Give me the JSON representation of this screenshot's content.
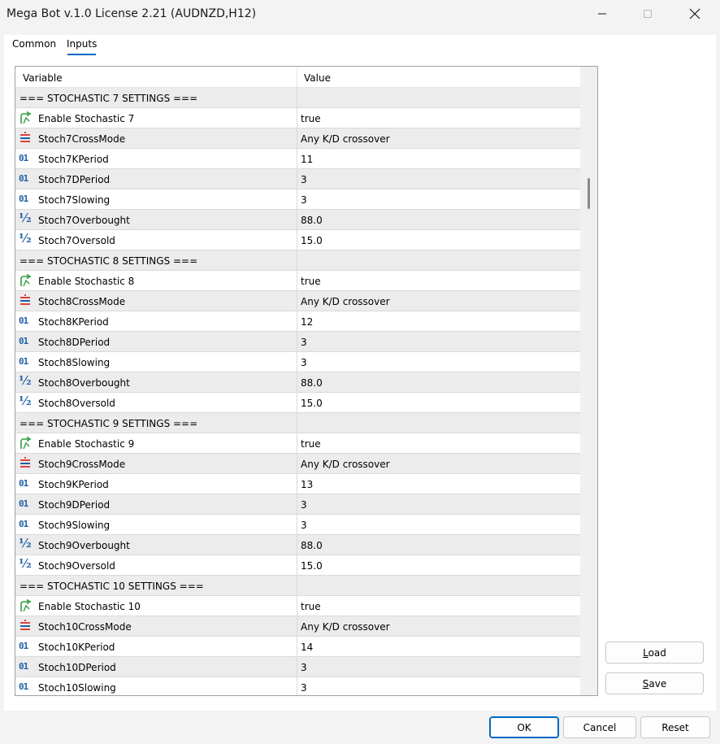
{
  "window": {
    "title": "Mega Bot v.1.0 License 2.21 (AUDNZD,H12)"
  },
  "tabs": [
    {
      "label": "Common"
    },
    {
      "label": "Inputs"
    }
  ],
  "grid": {
    "columns": {
      "variable": "Variable",
      "value": "Value"
    },
    "rows": [
      {
        "type": "section",
        "variable": "=== STOCHASTIC 7 SETTINGS ===",
        "value": ""
      },
      {
        "type": "bool",
        "icon": "bool-arrow-icon",
        "variable": "Enable Stochastic 7",
        "value": "true"
      },
      {
        "type": "enum",
        "icon": "enum-list-icon",
        "variable": "Stoch7CrossMode",
        "value": "Any K/D crossover"
      },
      {
        "type": "int",
        "icon": "integer-icon",
        "variable": "Stoch7KPeriod",
        "value": "11"
      },
      {
        "type": "int",
        "icon": "integer-icon",
        "variable": "Stoch7DPeriod",
        "value": "3"
      },
      {
        "type": "int",
        "icon": "integer-icon",
        "variable": "Stoch7Slowing",
        "value": "3"
      },
      {
        "type": "double",
        "icon": "fraction-icon",
        "variable": "Stoch7Overbought",
        "value": "88.0"
      },
      {
        "type": "double",
        "icon": "fraction-icon",
        "variable": "Stoch7Oversold",
        "value": "15.0"
      },
      {
        "type": "section",
        "variable": "=== STOCHASTIC 8 SETTINGS ===",
        "value": ""
      },
      {
        "type": "bool",
        "icon": "bool-arrow-icon",
        "variable": "Enable Stochastic 8",
        "value": "true"
      },
      {
        "type": "enum",
        "icon": "enum-list-icon",
        "variable": "Stoch8CrossMode",
        "value": "Any K/D crossover"
      },
      {
        "type": "int",
        "icon": "integer-icon",
        "variable": "Stoch8KPeriod",
        "value": "12"
      },
      {
        "type": "int",
        "icon": "integer-icon",
        "variable": "Stoch8DPeriod",
        "value": "3"
      },
      {
        "type": "int",
        "icon": "integer-icon",
        "variable": "Stoch8Slowing",
        "value": "3"
      },
      {
        "type": "double",
        "icon": "fraction-icon",
        "variable": "Stoch8Overbought",
        "value": "88.0"
      },
      {
        "type": "double",
        "icon": "fraction-icon",
        "variable": "Stoch8Oversold",
        "value": "15.0"
      },
      {
        "type": "section",
        "variable": "=== STOCHASTIC 9 SETTINGS ===",
        "value": ""
      },
      {
        "type": "bool",
        "icon": "bool-arrow-icon",
        "variable": "Enable Stochastic 9",
        "value": "true"
      },
      {
        "type": "enum",
        "icon": "enum-list-icon",
        "variable": "Stoch9CrossMode",
        "value": "Any K/D crossover"
      },
      {
        "type": "int",
        "icon": "integer-icon",
        "variable": "Stoch9KPeriod",
        "value": "13"
      },
      {
        "type": "int",
        "icon": "integer-icon",
        "variable": "Stoch9DPeriod",
        "value": "3"
      },
      {
        "type": "int",
        "icon": "integer-icon",
        "variable": "Stoch9Slowing",
        "value": "3"
      },
      {
        "type": "double",
        "icon": "fraction-icon",
        "variable": "Stoch9Overbought",
        "value": "88.0"
      },
      {
        "type": "double",
        "icon": "fraction-icon",
        "variable": "Stoch9Oversold",
        "value": "15.0"
      },
      {
        "type": "section",
        "variable": "=== STOCHASTIC 10 SETTINGS ===",
        "value": ""
      },
      {
        "type": "bool",
        "icon": "bool-arrow-icon",
        "variable": "Enable Stochastic 10",
        "value": "true"
      },
      {
        "type": "enum",
        "icon": "enum-list-icon",
        "variable": "Stoch10CrossMode",
        "value": "Any K/D crossover"
      },
      {
        "type": "int",
        "icon": "integer-icon",
        "variable": "Stoch10KPeriod",
        "value": "14"
      },
      {
        "type": "int",
        "icon": "integer-icon",
        "variable": "Stoch10DPeriod",
        "value": "3"
      },
      {
        "type": "int",
        "icon": "integer-icon",
        "variable": "Stoch10Slowing",
        "value": "3"
      }
    ]
  },
  "side_buttons": {
    "load_label": "Load",
    "save_label": "Save"
  },
  "dialog_buttons": {
    "ok_label": "OK",
    "cancel_label": "Cancel",
    "reset_label": "Reset"
  },
  "colors": {
    "accent": "#0067c0",
    "bool_icon": "#2e9e3e",
    "enum_icon_red": "#d9453c",
    "enum_icon_blue": "#1f5fa8",
    "int_icon": "#1f5fa8",
    "alt_row": "#ececec"
  }
}
